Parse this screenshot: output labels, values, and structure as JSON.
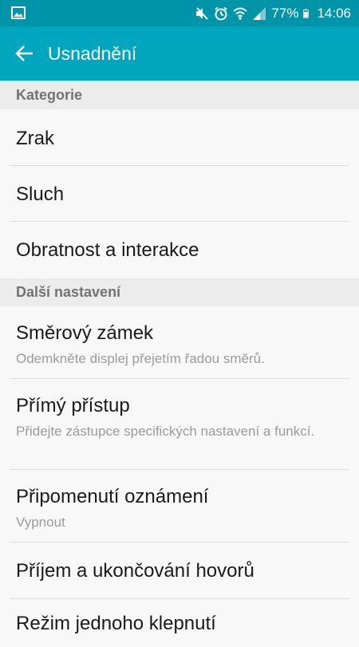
{
  "status_bar": {
    "battery_percent": "77%",
    "time": "14:06",
    "icons": [
      "image-icon",
      "mute-icon",
      "alarm-icon",
      "wifi-icon",
      "signal-icon",
      "battery-icon"
    ]
  },
  "app_bar": {
    "title": "Usnadnění",
    "back_icon": "arrow-left-icon",
    "background_color": "#00a6bd",
    "status_color": "#0094a8"
  },
  "sections": [
    {
      "header": "Kategorie",
      "items": [
        {
          "label": "Zrak"
        },
        {
          "label": "Sluch"
        },
        {
          "label": "Obratnost a interakce"
        }
      ]
    },
    {
      "header": "Další nastavení",
      "items": [
        {
          "label": "Směrový zámek",
          "sub": "Odemkněte displej přejetím řadou směrů."
        },
        {
          "label": "Přímý přístup",
          "sub": "Přidejte zástupce specifických nastavení a funkcí."
        },
        {
          "label": "Připomenutí oznámení",
          "sub": "Vypnout"
        },
        {
          "label": "Příjem a ukončování hovorů"
        },
        {
          "label": "Režim jednoho klepnutí"
        }
      ]
    }
  ]
}
